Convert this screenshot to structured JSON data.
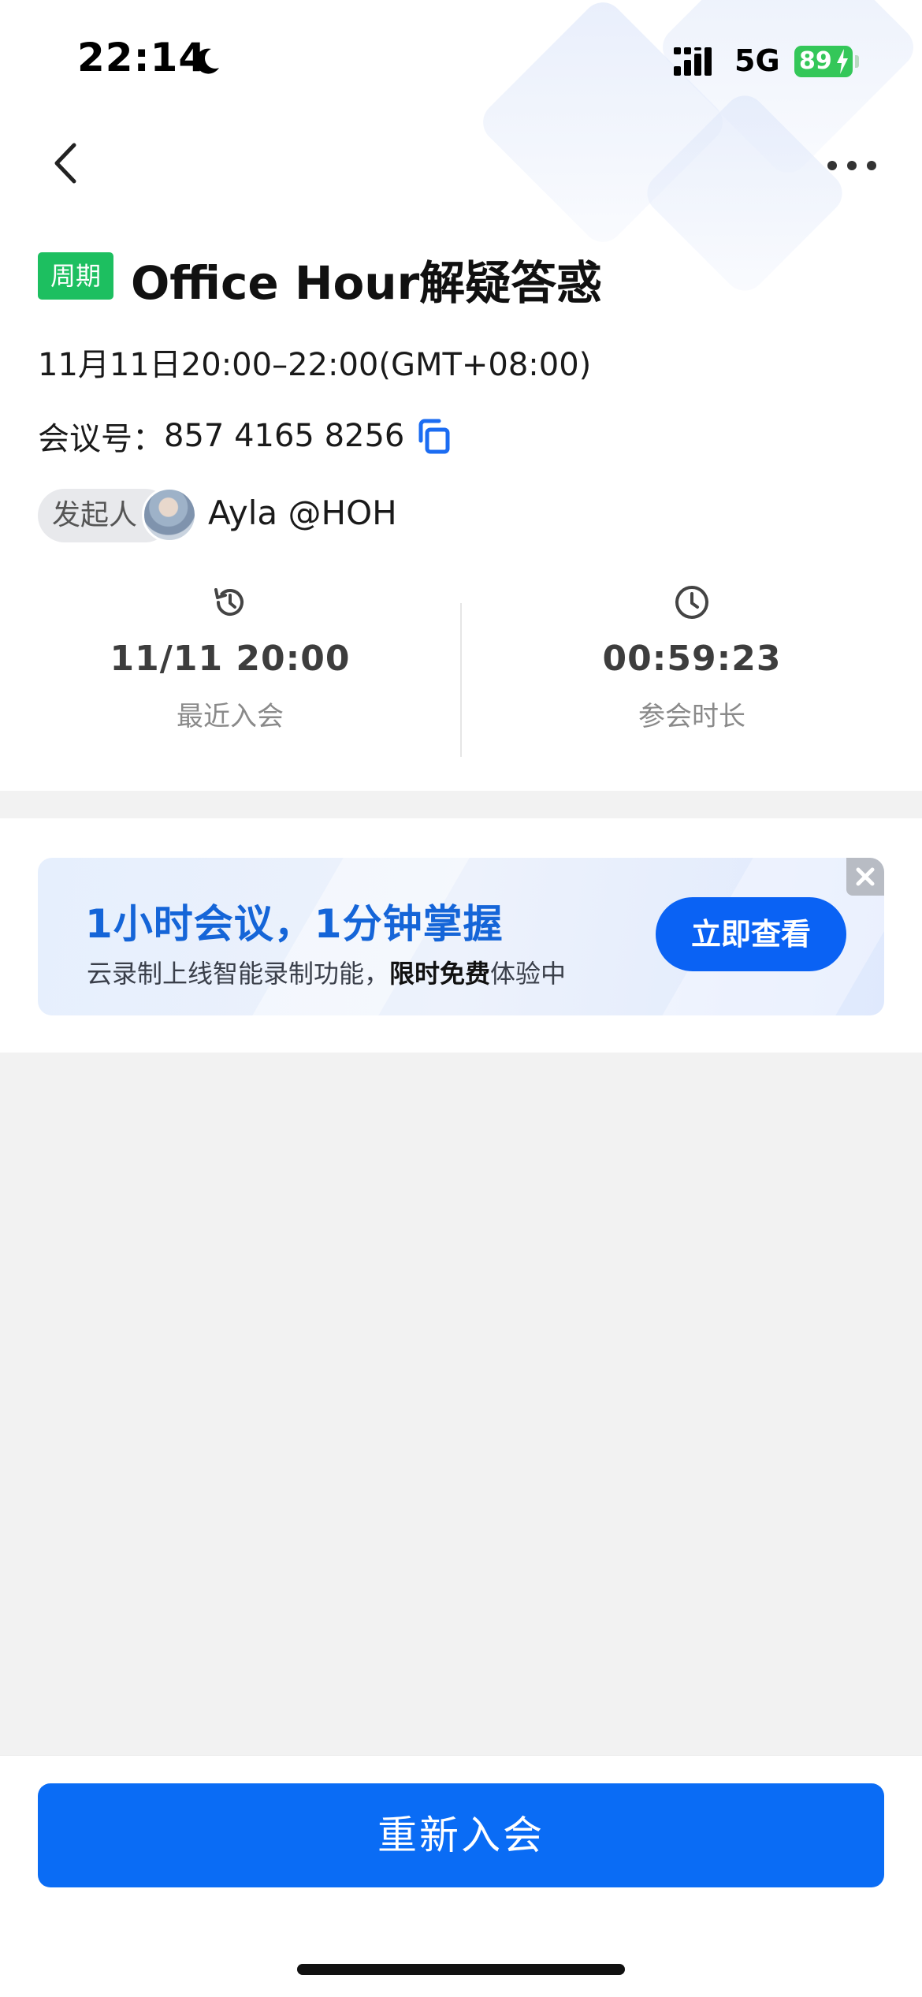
{
  "status_bar": {
    "time": "22:14",
    "network": "5G",
    "battery": "89"
  },
  "meeting": {
    "tag": "周期",
    "title": "Office Hour解疑答惑",
    "time_range": "11月11日20:00–22:00(GMT+08:00)",
    "id_label": "会议号：",
    "id_value": "857 4165 8256",
    "organizer_label": "发起人",
    "organizer_name": "Ayla @HOH"
  },
  "stats": [
    {
      "icon": "history-icon",
      "value": "11/11 20:00",
      "label": "最近入会"
    },
    {
      "icon": "clock-icon",
      "value": "00:59:23",
      "label": "参会时长"
    }
  ],
  "promo": {
    "title": "1小时会议，1分钟掌握",
    "subtitle_prefix": "云录制上线智能录制功能，",
    "subtitle_bold": "限时免费",
    "subtitle_suffix": "体验中",
    "cta": "立即查看"
  },
  "bottom": {
    "rejoin": "重新入会"
  },
  "colors": {
    "primary": "#0a6cf5",
    "tag_green": "#1dbf60",
    "promo_title": "#1565d8",
    "battery_green": "#34c759"
  }
}
